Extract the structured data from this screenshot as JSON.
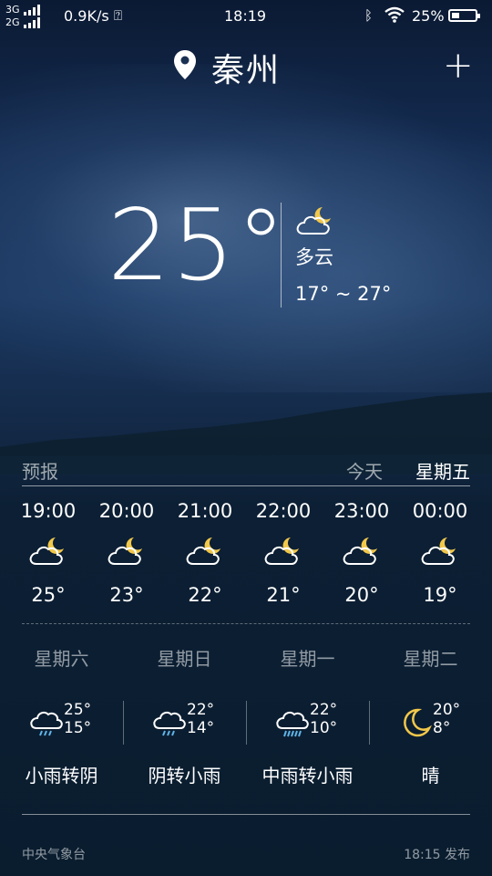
{
  "status_bar": {
    "net_top": "3G",
    "net_bottom": "2G",
    "speed": "0.9K/s",
    "time": "18:19",
    "battery": "25%"
  },
  "header": {
    "city": "秦州",
    "add": "+"
  },
  "current": {
    "temp": "25°",
    "condition": "多云",
    "range": "17° ~ 27°"
  },
  "forecast": {
    "label": "预报",
    "today": "今天",
    "selected_day": "星期五",
    "hourly": [
      {
        "time": "19:00",
        "icon": "cloud-moon-icon",
        "temp": "25°"
      },
      {
        "time": "20:00",
        "icon": "cloud-moon-icon",
        "temp": "23°"
      },
      {
        "time": "21:00",
        "icon": "cloud-moon-icon",
        "temp": "22°"
      },
      {
        "time": "22:00",
        "icon": "cloud-moon-icon",
        "temp": "21°"
      },
      {
        "time": "23:00",
        "icon": "cloud-moon-icon",
        "temp": "20°"
      },
      {
        "time": "00:00",
        "icon": "cloud-moon-icon",
        "temp": "19°"
      }
    ]
  },
  "daily": [
    {
      "day": "星期六",
      "icon": "rain-cloud-icon",
      "high": "25°",
      "low": "15°",
      "condition": "小雨转阴"
    },
    {
      "day": "星期日",
      "icon": "rain-cloud-icon",
      "high": "22°",
      "low": "14°",
      "condition": "阴转小雨"
    },
    {
      "day": "星期一",
      "icon": "heavy-rain-cloud-icon",
      "high": "22°",
      "low": "10°",
      "condition": "中雨转小雨"
    },
    {
      "day": "星期二",
      "icon": "moon-icon",
      "high": "20°",
      "low": "8°",
      "condition": "晴"
    }
  ],
  "footer": {
    "source": "中央气象台",
    "published": "18:15 发布"
  },
  "colors": {
    "moon": "#f2c84b",
    "rain": "#5fb4e8"
  }
}
